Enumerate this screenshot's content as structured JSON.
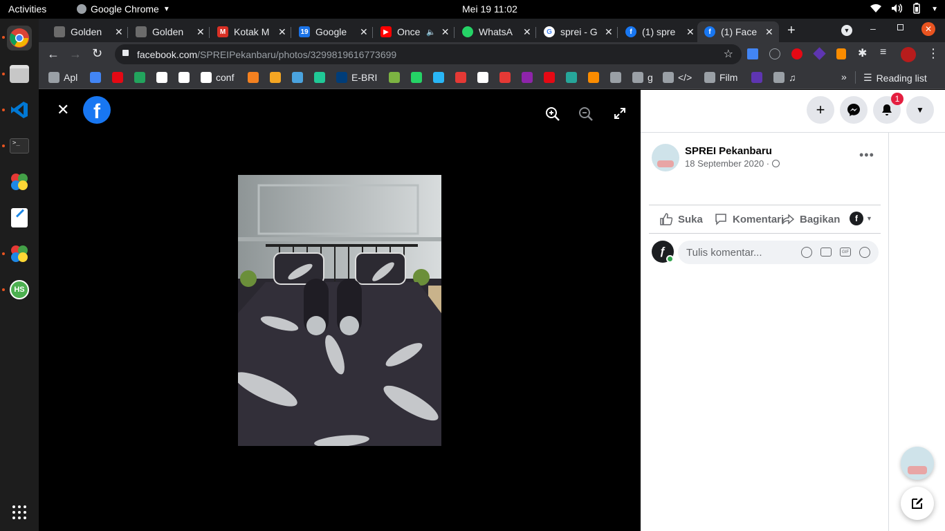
{
  "topbar": {
    "activities": "Activities",
    "app_name": "Google Chrome",
    "clock": "Mei 19  11:02"
  },
  "tabs": [
    {
      "title": "Golden",
      "favicon_color": "#6b6b6b"
    },
    {
      "title": "Golden",
      "favicon_color": "#6b6b6b"
    },
    {
      "title": "Kotak M",
      "favicon_color": "#d93025"
    },
    {
      "title": "Google",
      "favicon_color": "#1a73e8"
    },
    {
      "title": "Once",
      "favicon_color": "#ff0000"
    },
    {
      "title": "WhatsA",
      "favicon_color": "#25d366"
    },
    {
      "title": "sprei - G",
      "favicon_color": "#4285f4"
    },
    {
      "title": "(1) spre",
      "favicon_color": "#1877f2"
    },
    {
      "title": "(1) Face",
      "favicon_color": "#1877f2",
      "active": true
    }
  ],
  "address_bar": {
    "domain": "facebook.com",
    "path": "/SPREIPekanbaru/photos/3299819616773699"
  },
  "bookmarks": [
    {
      "label": "Apl",
      "color": "#9aa0a6"
    },
    {
      "label": "",
      "color": "#4285f4"
    },
    {
      "label": "",
      "color": "#e50914"
    },
    {
      "label": "",
      "color": "#22a45d"
    },
    {
      "label": "",
      "color": "#ffffff"
    },
    {
      "label": "",
      "color": "#ffffff"
    },
    {
      "label": "conf",
      "color": "#ffffff"
    },
    {
      "label": "",
      "color": "#f48120"
    },
    {
      "label": "",
      "color": "#f5a623"
    },
    {
      "label": "",
      "color": "#4aa3df"
    },
    {
      "label": "",
      "color": "#20c997"
    },
    {
      "label": "E-BRI",
      "color": "#003d79"
    },
    {
      "label": "",
      "color": "#7cb342"
    },
    {
      "label": "",
      "color": "#25d366"
    },
    {
      "label": "",
      "color": "#29b6f6"
    },
    {
      "label": "",
      "color": "#e53935"
    },
    {
      "label": "",
      "color": "#ffffff"
    },
    {
      "label": "",
      "color": "#e53935"
    },
    {
      "label": "",
      "color": "#8e24aa"
    },
    {
      "label": "",
      "color": "#e50914"
    },
    {
      "label": "",
      "color": "#26a69a"
    },
    {
      "label": "",
      "color": "#fb8c00"
    },
    {
      "label": "",
      "color": "#9aa0a6"
    },
    {
      "label": "g",
      "color": "#9aa0a6"
    },
    {
      "label": "</>",
      "color": "#9aa0a6"
    },
    {
      "label": "Film",
      "color": "#9aa0a6"
    },
    {
      "label": "",
      "color": "#5e35b1"
    },
    {
      "label": "♫",
      "color": "#9aa0a6"
    }
  ],
  "reading_list": "Reading list",
  "viewer": {
    "photo_description": "bedsheet photo"
  },
  "post": {
    "page_name": "SPREI Pekanbaru",
    "date": "18 September 2020 ·",
    "like": "Suka",
    "comment": "Komentari",
    "share": "Bagikan",
    "comment_placeholder": "Tulis komentar...",
    "notification_count": "1"
  },
  "colors": {
    "facebook_blue": "#1877f2",
    "panel_bg": "#ffffff",
    "viewer_bg": "#000000",
    "notification_red": "#e41e3f"
  }
}
